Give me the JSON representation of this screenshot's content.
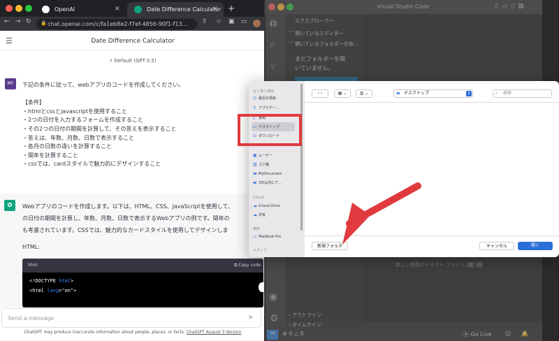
{
  "browser": {
    "tabs": [
      {
        "label": "OpenAI"
      },
      {
        "label": "Date Difference Calculator"
      }
    ],
    "url": "chat.openai.com/c/fa1eb8e2-f7ef-4856-90f1-f13..."
  },
  "chatgpt": {
    "title": "Date Difference Calculator",
    "model": "Default (GPT-3.5)",
    "user_avatar": "MY",
    "user_lines": [
      "下記の条件に従って、webアプリのコードを作成してください。",
      "",
      "【条件】",
      "・htmlとcssとjavascriptを使用すること",
      "・2つの日付を入力するフォームを作成すること",
      "・その2つの日付の期間を計算して、その答えを表示すること",
      "・答えは、年数、月数、日数で表示すること",
      "・各月の日数の違いを計算すること",
      "・閏年を計算すること",
      "・cssでは、cardスタイルで魅力的にデザインすること"
    ],
    "bot_lines": [
      "Webアプリのコードを作成します。以下は、HTML、CSS、JavaScriptを使用して、",
      "の日付の期間を計算し、年数、月数、日数で表示するWebアプリの例です。閏年の",
      "も考慮されています。CSSでは、魅力的なカードスタイルを使用してデザインしま"
    ],
    "html_heading": "HTML:",
    "code_lang": "html",
    "copy_label": "Copy code",
    "code_lines": [
      {
        "a": "<!DOCTYPE ",
        "b": "html",
        "c": ">"
      },
      {
        "a": "<html ",
        "b": "lang",
        "c": "=\"en\">"
      }
    ],
    "input_placeholder": "Send a message",
    "footer": "ChatGPT may produce inaccurate information about people, places, or facts.",
    "footer_link": "ChatGPT August 3 Version"
  },
  "vscode": {
    "title": "Visual Studio Code",
    "explorer": "エクスプローラー",
    "open_editors": "開いているエディター",
    "no_folder": "開いているフォルダーがあ...",
    "no_folder_msg1": "まだフォルダーを開",
    "no_folder_msg2": "いていません。",
    "new_file_hint": "新しい無題のテキスト ファイル",
    "outline": "アウトライン",
    "timeline": "タイムライン",
    "status_counts": "⊗ 0  △ 0",
    "go_live": "Go Live"
  },
  "dialog": {
    "favorites_header": "よく使う項目",
    "sidebar_items": [
      {
        "label": "最近の項目",
        "icon": "clock-icon"
      },
      {
        "label": "アプリケー...",
        "icon": "apps-icon"
      },
      {
        "label": "書類",
        "icon": "document-icon"
      },
      {
        "label": "デスクトップ",
        "icon": "desktop-icon"
      },
      {
        "label": "ダウンロード",
        "icon": "download-icon"
      },
      {
        "label": "ムービー",
        "icon": "movie-icon"
      },
      {
        "label": "ゴミ箱",
        "icon": "trash-icon"
      },
      {
        "label": "MyDocument",
        "icon": "folder-icon"
      },
      {
        "label": "3日以内にア...",
        "icon": "folder-icon"
      }
    ],
    "icloud_header": "iCloud",
    "icloud_items": [
      {
        "label": "iCloud Drive"
      },
      {
        "label": "共有"
      }
    ],
    "locations_header": "場所",
    "location_items": [
      {
        "label": "MacBook Pro"
      }
    ],
    "media_header": "メディア",
    "location": "デスクトップ",
    "search_placeholder": "検索",
    "new_folder": "新規フォルダ",
    "cancel": "キャンセル",
    "open": "開く"
  },
  "colors": {
    "highlight_box": "#e03a3e",
    "arrow": "#e03a3e",
    "accent": "#2b6fd8"
  }
}
